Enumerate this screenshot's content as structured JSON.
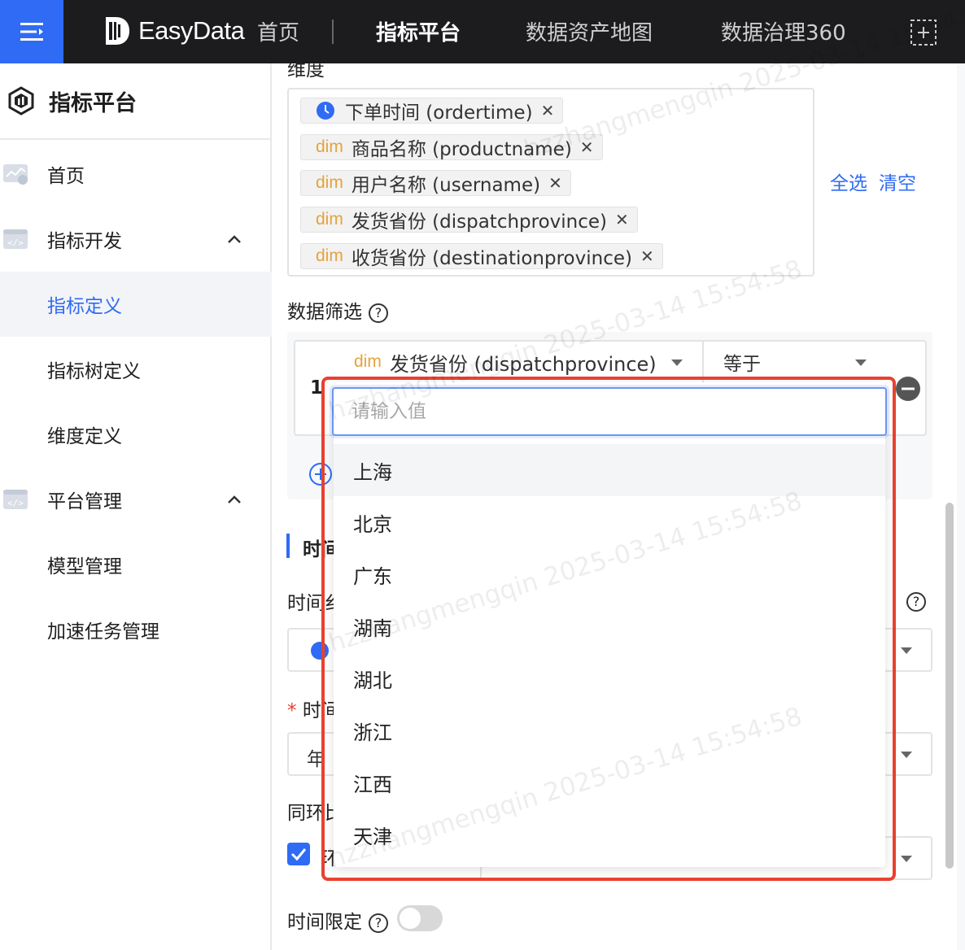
{
  "topbar": {
    "brand": "EasyData",
    "nav": [
      {
        "label": "首页",
        "active": false
      },
      {
        "label": "指标平台",
        "active": true
      },
      {
        "label": "数据资产地图",
        "active": false
      },
      {
        "label": "数据治理360",
        "active": false
      }
    ]
  },
  "sidebar": {
    "title": "指标平台",
    "items": [
      {
        "label": "首页"
      },
      {
        "label": "指标开发"
      },
      {
        "label": "指标定义"
      },
      {
        "label": "指标树定义"
      },
      {
        "label": "维度定义"
      },
      {
        "label": "平台管理"
      },
      {
        "label": "模型管理"
      },
      {
        "label": "加速任务管理"
      }
    ],
    "selected": "指标定义"
  },
  "main": {
    "dimension_label": "维度",
    "dimensions": [
      {
        "prefix": "",
        "label": "下单时间 (ordertime)"
      },
      {
        "prefix": "dim",
        "label": "商品名称 (productname)"
      },
      {
        "prefix": "dim",
        "label": "用户名称 (username)"
      },
      {
        "prefix": "dim",
        "label": "发货省份 (dispatchprovince)"
      },
      {
        "prefix": "dim",
        "label": "收货省份 (destinationprovince)"
      }
    ],
    "select_all": "全选",
    "clear": "清空",
    "data_filter_label": "数据筛选",
    "filter": {
      "row_number": "1",
      "field_prefix": "dim",
      "field": "发货省份 (dispatchprovince)",
      "operator": "等于"
    },
    "section_time_stub": "时间",
    "time_field_stub": "时间纟",
    "required_mark": "*",
    "time_granularity_stub": "时间",
    "year_stub": "年",
    "yoy_stub": "同环比",
    "mom_stub": "环",
    "time_limit_label": "时间限定"
  },
  "dropdown": {
    "placeholder": "请输入值",
    "options": [
      "上海",
      "北京",
      "广东",
      "湖南",
      "湖北",
      "浙江",
      "江西",
      "天津"
    ],
    "hovered": "上海"
  },
  "watermark": "hzzhangmengqin 2025-03-14 15:54:58",
  "colors": {
    "accent": "#2f6bf5",
    "dim_tag": "#e6a23c",
    "highlight": "#e8412f",
    "topbar": "#1c1c1e"
  }
}
